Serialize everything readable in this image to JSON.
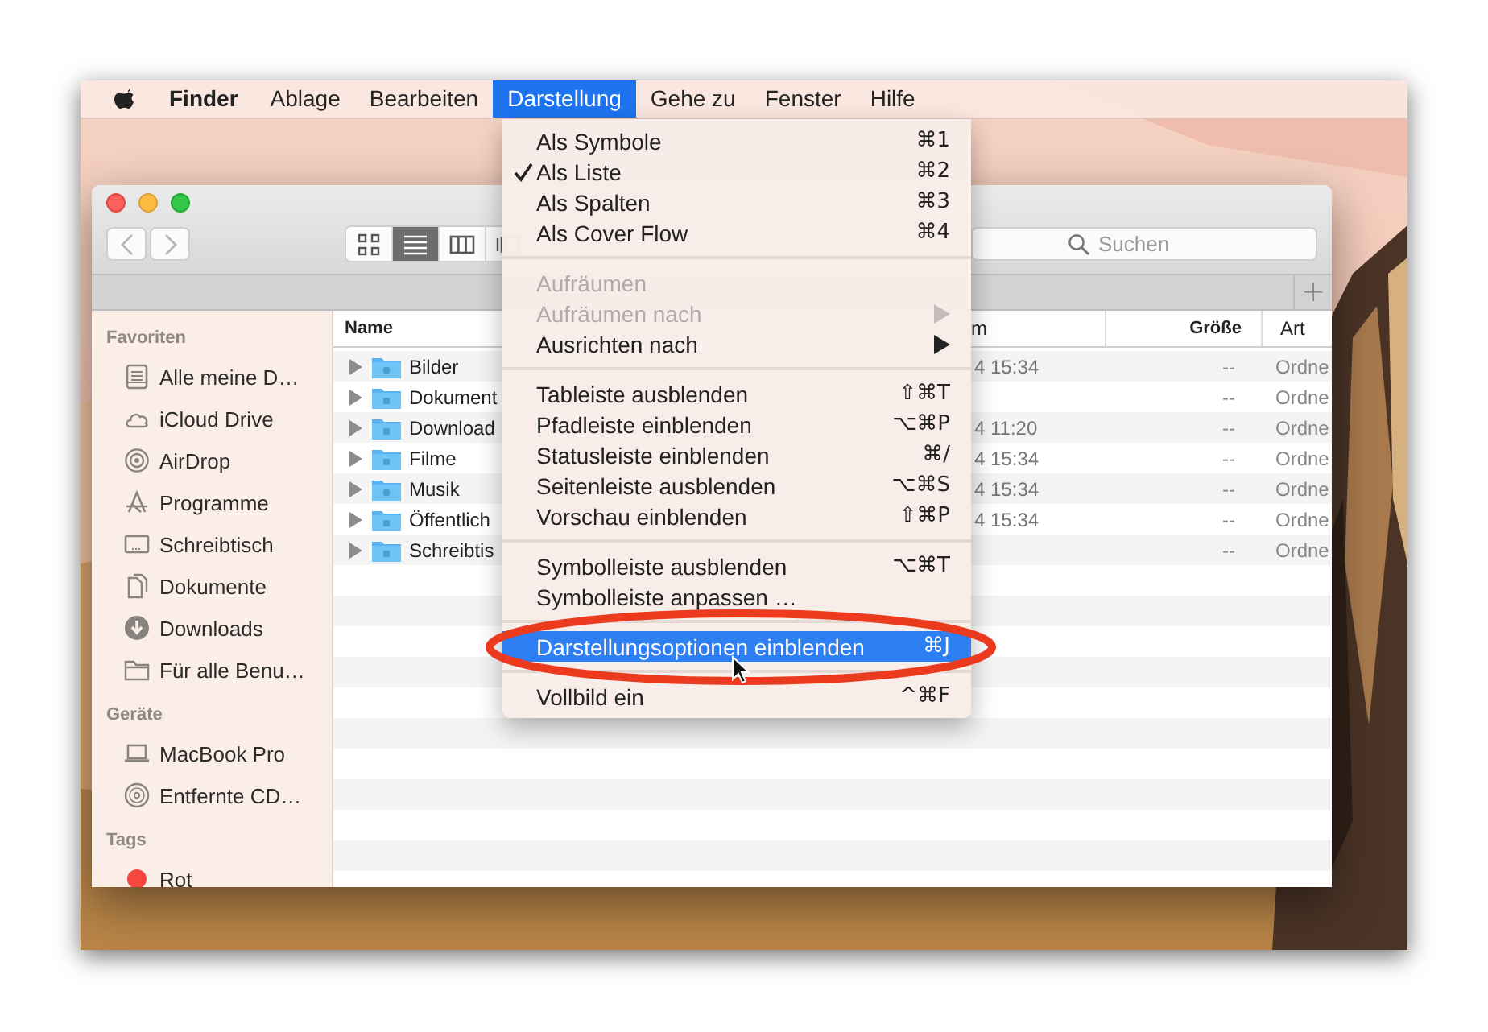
{
  "menubar": {
    "items": [
      {
        "label": "Finder",
        "kind": "app",
        "selected": false
      },
      {
        "label": "Ablage",
        "kind": "menu",
        "selected": false
      },
      {
        "label": "Bearbeiten",
        "kind": "menu",
        "selected": false
      },
      {
        "label": "Darstellung",
        "kind": "menu",
        "selected": true
      },
      {
        "label": "Gehe zu",
        "kind": "menu",
        "selected": false
      },
      {
        "label": "Fenster",
        "kind": "menu",
        "selected": false
      },
      {
        "label": "Hilfe",
        "kind": "menu",
        "selected": false
      }
    ]
  },
  "menu": {
    "groups": [
      [
        {
          "label": "Als Symbole",
          "shortcut": "⌘1",
          "checked": false,
          "disabled": false,
          "submenu": false,
          "selected": false
        },
        {
          "label": "Als Liste",
          "shortcut": "⌘2",
          "checked": true,
          "disabled": false,
          "submenu": false,
          "selected": false
        },
        {
          "label": "Als Spalten",
          "shortcut": "⌘3",
          "checked": false,
          "disabled": false,
          "submenu": false,
          "selected": false
        },
        {
          "label": "Als Cover Flow",
          "shortcut": "⌘4",
          "checked": false,
          "disabled": false,
          "submenu": false,
          "selected": false
        }
      ],
      [
        {
          "label": "Aufräumen",
          "checked": false,
          "disabled": true,
          "submenu": false,
          "selected": false
        },
        {
          "label": "Aufräumen nach",
          "checked": false,
          "disabled": true,
          "submenu": true,
          "selected": false
        },
        {
          "label": "Ausrichten nach",
          "checked": false,
          "disabled": false,
          "submenu": true,
          "selected": false
        }
      ],
      [
        {
          "label": "Tableiste ausblenden",
          "shortcut": "⇧⌘T",
          "checked": false,
          "disabled": false,
          "submenu": false,
          "selected": false
        },
        {
          "label": "Pfadleiste einblenden",
          "shortcut": "⌥⌘P",
          "checked": false,
          "disabled": false,
          "submenu": false,
          "selected": false
        },
        {
          "label": "Statusleiste einblenden",
          "shortcut": "⌘/",
          "checked": false,
          "disabled": false,
          "submenu": false,
          "selected": false
        },
        {
          "label": "Seitenleiste ausblenden",
          "shortcut": "⌥⌘S",
          "checked": false,
          "disabled": false,
          "submenu": false,
          "selected": false
        },
        {
          "label": "Vorschau einblenden",
          "shortcut": "⇧⌘P",
          "checked": false,
          "disabled": false,
          "submenu": false,
          "selected": false
        }
      ],
      [
        {
          "label": "Symbolleiste ausblenden",
          "shortcut": "⌥⌘T",
          "checked": false,
          "disabled": false,
          "submenu": false,
          "selected": false
        },
        {
          "label": "Symbolleiste anpassen …",
          "checked": false,
          "disabled": false,
          "submenu": false,
          "selected": false
        }
      ],
      [
        {
          "label": "Darstellungsoptionen einblenden",
          "shortcut": "⌘J",
          "checked": false,
          "disabled": false,
          "submenu": false,
          "selected": true
        }
      ],
      [
        {
          "label": "Vollbild ein",
          "shortcut": "^⌘F",
          "checked": false,
          "disabled": false,
          "submenu": false,
          "selected": false
        }
      ]
    ]
  },
  "window": {
    "view_buttons": [
      {
        "kind": "icons",
        "selected": false
      },
      {
        "kind": "list",
        "selected": true
      },
      {
        "kind": "columns",
        "selected": false
      },
      {
        "kind": "coverflow",
        "selected": false
      }
    ],
    "search": {
      "placeholder": "Suchen"
    },
    "tab_add": "+",
    "sidebar": [
      {
        "title": "Favoriten",
        "items": [
          {
            "label": "Alle meine D…",
            "kind": "place"
          },
          {
            "label": "iCloud Drive",
            "kind": "place"
          },
          {
            "label": "AirDrop",
            "kind": "place"
          },
          {
            "label": "Programme",
            "kind": "place"
          },
          {
            "label": "Schreibtisch",
            "kind": "place"
          },
          {
            "label": "Dokumente",
            "kind": "place"
          },
          {
            "label": "Downloads",
            "kind": "place"
          },
          {
            "label": "Für alle Benu…",
            "kind": "place"
          }
        ]
      },
      {
        "title": "Geräte",
        "items": [
          {
            "label": "MacBook Pro",
            "kind": "place"
          },
          {
            "label": "Entfernte CD…",
            "kind": "place"
          }
        ]
      },
      {
        "title": "Tags",
        "items": [
          {
            "label": "Rot",
            "kind": "tag",
            "color": "#f5473b"
          }
        ]
      }
    ],
    "table": {
      "columns": [
        "Name",
        "m",
        "Größe",
        "Art"
      ],
      "rows": [
        {
          "name": "Bilder",
          "date": "4 15:34",
          "size": "--",
          "kind": "Ordne"
        },
        {
          "name": "Dokument",
          "size": "--",
          "kind": "Ordne"
        },
        {
          "name": "Download",
          "date": "4 11:20",
          "size": "--",
          "kind": "Ordne"
        },
        {
          "name": "Filme",
          "date": "4 15:34",
          "size": "--",
          "kind": "Ordne"
        },
        {
          "name": "Musik",
          "date": "4 15:34",
          "size": "--",
          "kind": "Ordne"
        },
        {
          "name": "Öffentlich",
          "date": "4 15:34",
          "size": "--",
          "kind": "Ordne"
        },
        {
          "name": "Schreibtis",
          "size": "--",
          "kind": "Ordne"
        }
      ]
    }
  }
}
